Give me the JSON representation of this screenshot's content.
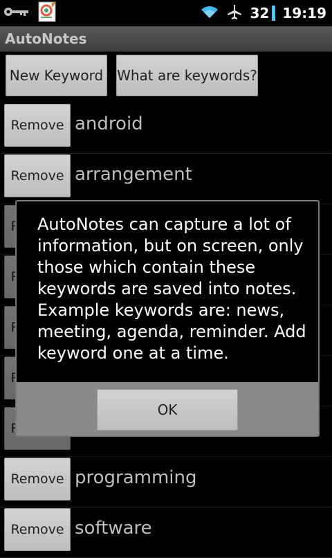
{
  "status_bar": {
    "battery_level": "32",
    "time": "19:19",
    "icons": [
      "key-icon",
      "app-notes-icon",
      "wifi-icon",
      "airplane-mode-icon",
      "battery-icon"
    ],
    "battery_color": "#43c7ff"
  },
  "app": {
    "title": "AutoNotes"
  },
  "toolbar": {
    "new_keyword_label": "New Keyword",
    "what_are_keywords_label": "What are keywords?"
  },
  "keywords": {
    "remove_label": "Remove",
    "items": [
      {
        "label": "android"
      },
      {
        "label": "arrangement"
      },
      {
        "label": ""
      },
      {
        "label": ""
      },
      {
        "label": ""
      },
      {
        "label": ""
      },
      {
        "label": ""
      },
      {
        "label": "programming"
      },
      {
        "label": "software"
      }
    ]
  },
  "dialog": {
    "message": "AutoNotes can capture a lot of information, but on screen, only those which contain these keywords are saved into notes. Example keywords are: news, meeting, agenda, reminder. Add keyword one at a time.",
    "ok_label": "OK"
  }
}
